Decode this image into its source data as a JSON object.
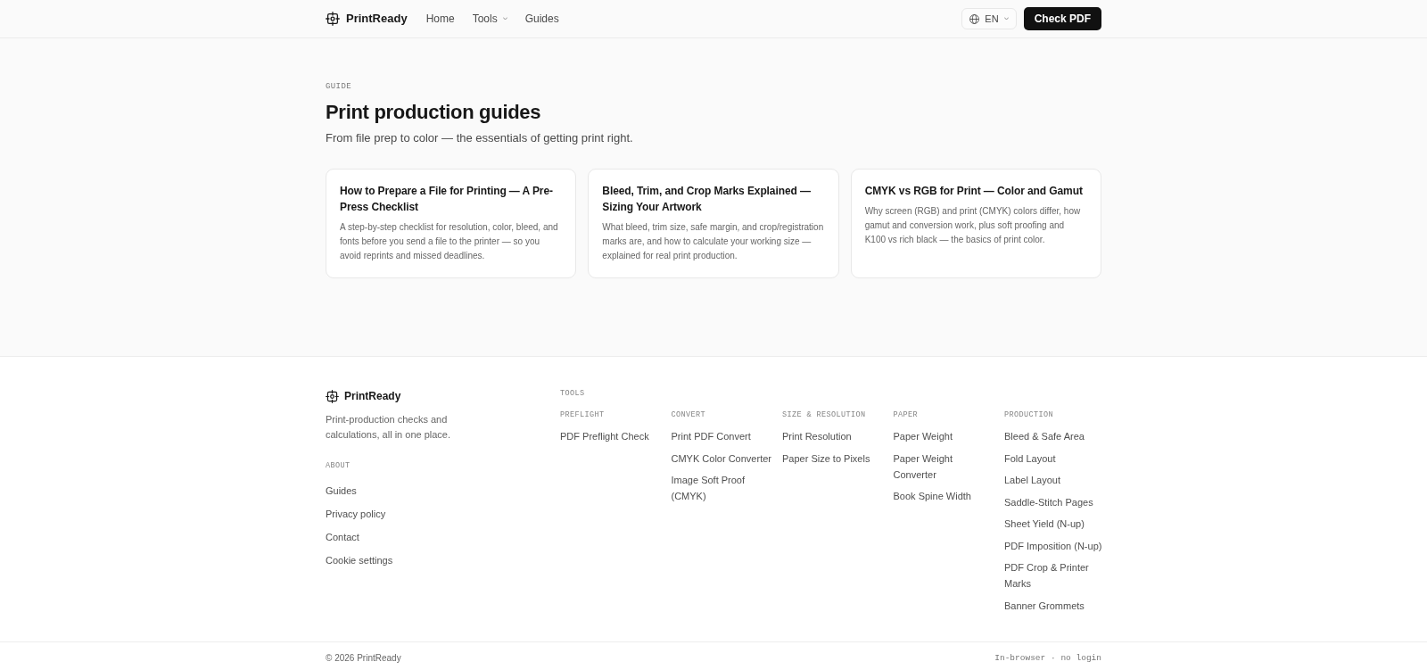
{
  "header": {
    "logo": "PrintReady",
    "nav": [
      {
        "label": "Home",
        "dropdown": false
      },
      {
        "label": "Tools",
        "dropdown": true
      },
      {
        "label": "Guides",
        "dropdown": false
      }
    ],
    "language": "EN",
    "cta": "Check PDF"
  },
  "hero": {
    "eyebrow": "GUIDE",
    "title": "Print production guides",
    "subtitle": "From file prep to color — the essentials of getting print right."
  },
  "guides": [
    {
      "title": "How to Prepare a File for Printing — A Pre-Press Checklist",
      "description": "A step-by-step checklist for resolution, color, bleed, and fonts before you send a file to the printer — so you avoid reprints and missed deadlines."
    },
    {
      "title": "Bleed, Trim, and Crop Marks Explained — Sizing Your Artwork",
      "description": "What bleed, trim size, safe margin, and crop/registration marks are, and how to calculate your working size — explained for real print production."
    },
    {
      "title": "CMYK vs RGB for Print — Color and Gamut",
      "description": "Why screen (RGB) and print (CMYK) colors differ, how gamut and conversion work, plus soft proofing and K100 vs rich black — the basics of print color."
    }
  ],
  "footer": {
    "logo": "PrintReady",
    "tagline": "Print-production checks and calculations, all in one place.",
    "about": {
      "heading": "ABOUT",
      "links": [
        "Guides",
        "Privacy policy",
        "Contact",
        "Cookie settings"
      ]
    },
    "tools": {
      "heading": "TOOLS",
      "columns": [
        {
          "heading": "PREFLIGHT",
          "links": [
            "PDF Preflight Check"
          ]
        },
        {
          "heading": "CONVERT",
          "links": [
            "Print PDF Convert",
            "CMYK Color Converter",
            "Image Soft Proof (CMYK)"
          ]
        },
        {
          "heading": "SIZE & RESOLUTION",
          "links": [
            "Print Resolution",
            "Paper Size to Pixels"
          ]
        },
        {
          "heading": "PAPER",
          "links": [
            "Paper Weight",
            "Paper Weight Converter",
            "Book Spine Width"
          ]
        },
        {
          "heading": "PRODUCTION",
          "links": [
            "Bleed & Safe Area",
            "Fold Layout",
            "Label Layout",
            "Saddle-Stitch Pages",
            "Sheet Yield (N-up)",
            "PDF Imposition (N-up)",
            "PDF Crop & Printer Marks",
            "Banner Grommets"
          ]
        }
      ]
    }
  },
  "bottom_bar": {
    "copyright": "© 2026 PrintReady",
    "note": "In-browser · no login"
  }
}
